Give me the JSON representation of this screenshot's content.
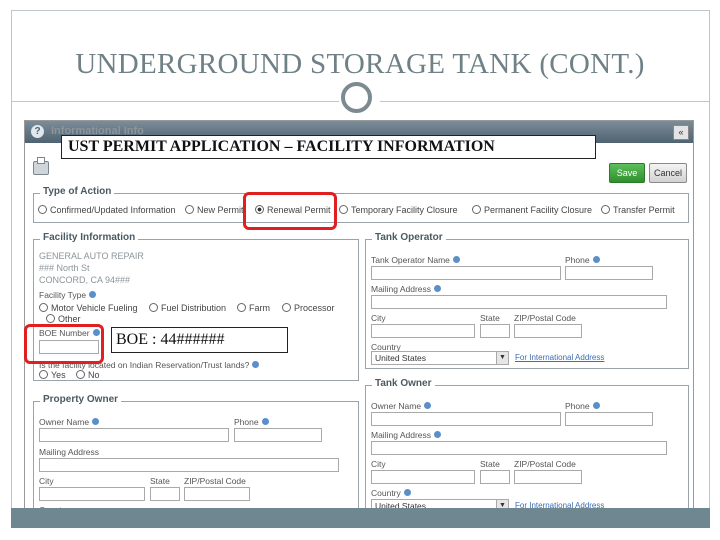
{
  "slide": {
    "title": "UNDERGROUND STORAGE TANK (CONT.)"
  },
  "form": {
    "header_title": "Informational Info",
    "buttons": {
      "save": "Save",
      "cancel": "Cancel"
    },
    "type_of_action": {
      "title": "Type of Action",
      "options": [
        {
          "label": "Confirmed/Updated Information",
          "selected": false
        },
        {
          "label": "New Permit",
          "selected": false
        },
        {
          "label": "Renewal Permit",
          "selected": true
        },
        {
          "label": "Temporary Facility Closure",
          "selected": false
        },
        {
          "label": "Permanent Facility Closure",
          "selected": false
        },
        {
          "label": "Transfer Permit",
          "selected": false
        }
      ]
    },
    "facility_info": {
      "title": "Facility Information",
      "name": "GENERAL AUTO REPAIR",
      "address": "### North St",
      "city_line": "CONCORD, CA 94###",
      "facility_type_label": "Facility Type",
      "facility_types": [
        "Motor Vehicle Fueling",
        "Fuel Distribution",
        "Farm",
        "Processor",
        "Other"
      ],
      "boe_label": "BOE Number",
      "indian_reservation_label": "Is the facility located on Indian Reservation/Trust lands?",
      "yes_no": [
        "Yes",
        "No"
      ]
    },
    "tank_operator": {
      "title": "Tank Operator",
      "name_label": "Tank Operator Name",
      "phone_label": "Phone",
      "mailing_label": "Mailing Address",
      "city_label": "City",
      "state_label": "State",
      "zip_label": "ZIP/Postal Code",
      "country_label": "Country",
      "country_value": "United States",
      "intl_link": "For International Address"
    },
    "property_owner": {
      "title": "Property Owner",
      "name_label": "Owner Name",
      "phone_label": "Phone",
      "mailing_label": "Mailing Address",
      "city_label": "City",
      "state_label": "State",
      "zip_label": "ZIP/Postal Code",
      "country_label": "Country"
    },
    "tank_owner": {
      "title": "Tank Owner",
      "name_label": "Owner Name",
      "phone_label": "Phone",
      "mailing_label": "Mailing Address",
      "city_label": "City",
      "state_label": "State",
      "zip_label": "ZIP/Postal Code",
      "country_label": "Country",
      "country_value": "United States",
      "intl_link": "For International Address"
    }
  },
  "callouts": {
    "application_title": "UST PERMIT APPLICATION – FACILITY INFORMATION",
    "boe": "BOE : 44######"
  }
}
